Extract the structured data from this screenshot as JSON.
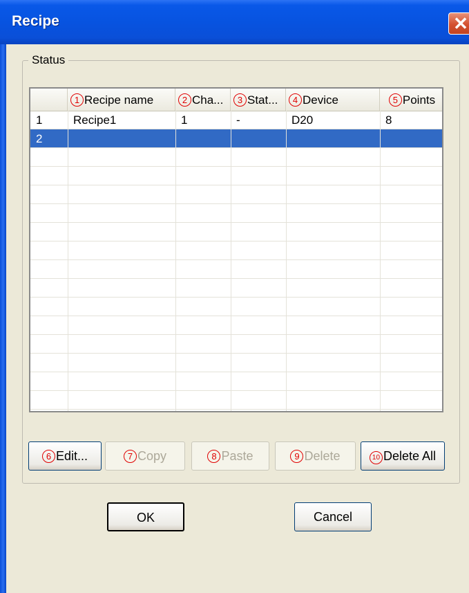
{
  "window": {
    "title": "Recipe",
    "close_glyph": "✕"
  },
  "group": {
    "label": "Status"
  },
  "table": {
    "columns": [
      {
        "marker": "1",
        "label": "Recipe name"
      },
      {
        "marker": "2",
        "label": "Cha..."
      },
      {
        "marker": "3",
        "label": "Stat..."
      },
      {
        "marker": "4",
        "label": "Device"
      },
      {
        "marker": "5",
        "label": "Points"
      }
    ],
    "rows": [
      {
        "no": "1",
        "name": "Recipe1",
        "ch": "1",
        "status": "-",
        "device": "D20",
        "points": "8",
        "selected": false
      },
      {
        "no": "2",
        "name": "",
        "ch": "",
        "status": "",
        "device": "",
        "points": "",
        "selected": true
      }
    ]
  },
  "buttons": {
    "edit": {
      "marker": "6",
      "label": "Edit..."
    },
    "copy": {
      "marker": "7",
      "label": "Copy"
    },
    "paste": {
      "marker": "8",
      "label": "Paste"
    },
    "delete": {
      "marker": "9",
      "label": "Delete"
    },
    "delete_all": {
      "marker": "10",
      "label": "Delete All"
    },
    "ok": "OK",
    "cancel": "Cancel"
  },
  "colors": {
    "selection": "#316ac5",
    "marker": "#e00000",
    "titlebar": "#0753e0"
  }
}
